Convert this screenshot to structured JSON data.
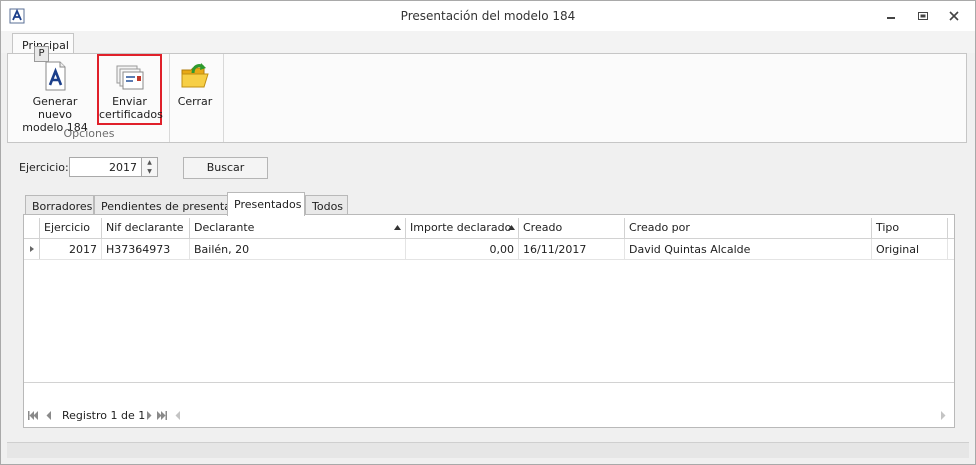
{
  "window": {
    "title": "Presentación del modelo 184",
    "icons": [
      "app-icon",
      "minimize-icon",
      "restore-icon",
      "close-icon"
    ]
  },
  "ribbon": {
    "tab_label": "Principal",
    "keytip": "P",
    "group_label": "Opciones",
    "buttons": [
      {
        "line1": "Generar nuevo",
        "line2": "modelo 184",
        "icon": "document-a-icon"
      },
      {
        "line1": "Enviar",
        "line2": "certificados",
        "icon": "certificates-icon"
      },
      {
        "line1": "Cerrar",
        "line2": "",
        "icon": "folder-exit-icon"
      }
    ]
  },
  "filter": {
    "ejercicio_label": "Ejercicio:",
    "ejercicio_value": "2017",
    "buscar_label": "Buscar"
  },
  "tabs": [
    {
      "label": "Borradores"
    },
    {
      "label": "Pendientes de presentar"
    },
    {
      "label": "Presentados",
      "active": true
    },
    {
      "label": "Todos"
    }
  ],
  "grid": {
    "columns": [
      {
        "label": "Ejercicio"
      },
      {
        "label": "Nif declarante"
      },
      {
        "label": "Declarante"
      },
      {
        "label": "Importe declarado"
      },
      {
        "label": "Creado"
      },
      {
        "label": "Creado por"
      },
      {
        "label": "Tipo"
      }
    ],
    "rows": [
      [
        "2017",
        "H37364973",
        "Bailén, 20",
        "0,00",
        "16/11/2017",
        "David Quintas Alcalde",
        "Original"
      ]
    ]
  },
  "navigator": {
    "record_text": "Registro 1 de 1"
  },
  "colors": {
    "highlight_border": "#e0202a",
    "ribbon_bg": "#fbfbfb",
    "window_bg": "#f0f0f0"
  }
}
